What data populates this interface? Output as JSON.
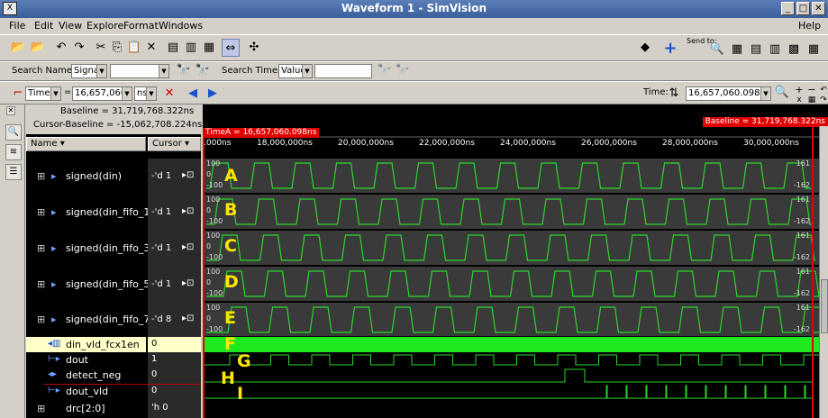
{
  "window": {
    "title": "Waveform 1 - SimVision",
    "app_icon": "X"
  },
  "menu": {
    "items": [
      "File",
      "Edit",
      "View",
      "Explore",
      "Format",
      "Windows"
    ],
    "help": "Help"
  },
  "toolbar1": {
    "send_to_label": "Send to:"
  },
  "search": {
    "names_label": "Search Names:",
    "names_mode": "Signal",
    "times_label": "Search Times:",
    "times_mode": "Value"
  },
  "cursorbar": {
    "cursor_name": "TimeA",
    "equals": "=",
    "cursor_time": "16,657,060.0",
    "unit": "ns",
    "time_label": "Time:",
    "time_value": "16,657,060.098ns"
  },
  "baseline": {
    "baseline_text": "Baseline = 31,719,768.322ns",
    "cursor_baseline_text": "Cursor-Baseline = -15,062,708.224ns",
    "marker_baseline": "Baseline = 31,719,768.322ns",
    "marker_timea": "TimeA = 16,657,060.098ns"
  },
  "columns": {
    "name": "Name",
    "cursor": "Cursor"
  },
  "signals": [
    {
      "name": "signed(din)",
      "cursor": "-'d 1",
      "label": "A"
    },
    {
      "name": "signed(din_fifo_1)",
      "cursor": "-'d 1",
      "label": "B"
    },
    {
      "name": "signed(din_fifo_3)",
      "cursor": "-'d 1",
      "label": "C"
    },
    {
      "name": "signed(din_fifo_5)",
      "cursor": "-'d 1",
      "label": "D"
    },
    {
      "name": "signed(din_fifo_7)",
      "cursor": "-'d 8",
      "label": "E"
    },
    {
      "name": "din_vld_fcx1en",
      "cursor": "0",
      "label": "F"
    },
    {
      "name": "dout",
      "cursor": "1",
      "label": "G"
    },
    {
      "name": "detect_neg",
      "cursor": "0",
      "label": "H"
    },
    {
      "name": "dout_vld",
      "cursor": "0",
      "label": "I"
    },
    {
      "name": "drc[2:0]",
      "cursor": "'h 0",
      "label": ""
    }
  ],
  "axis": {
    "ticks": [
      ".000ns",
      "18,000,000ns",
      "20,000,000ns",
      "22,000,000ns",
      "24,000,000ns",
      "26,000,000ns",
      "28,000,000ns",
      "30,000,000ns"
    ],
    "scale_left": [
      "100",
      "0",
      "-100"
    ],
    "scale_right": [
      "161",
      "-162"
    ]
  },
  "colors": {
    "wave": "#2ad62a",
    "marker": "#e00000",
    "label": "#ffe600"
  }
}
